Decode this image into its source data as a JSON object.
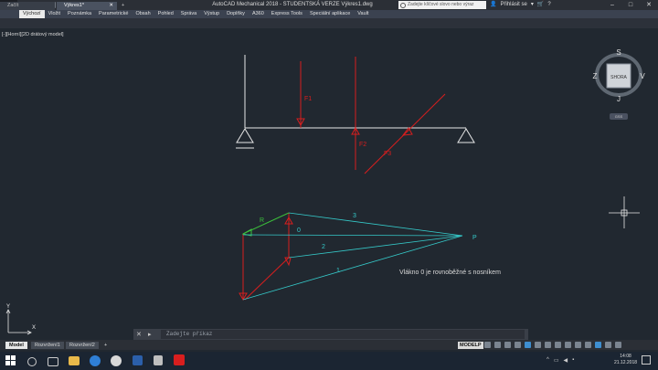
{
  "window": {
    "title": "AutoCAD Mechanical 2018 - STUDENTSKÁ VERZE    Výkres1.dwg",
    "search_placeholder": "Zadejte klíčové slovo nebo výraz",
    "login_label": "Přihlásit se",
    "controls": {
      "minimize": "–",
      "maximize": "□",
      "close": "✕"
    }
  },
  "app_logo": "A",
  "ribbon_tabs": [
    "Výchozí",
    "Vložit",
    "Poznámka",
    "Parametrické",
    "Obsah",
    "Pohled",
    "Správa",
    "Výstup",
    "Doplňky",
    "A360",
    "Express Tools",
    "Speciální aplikace",
    "Vault"
  ],
  "doc_tabs": {
    "start": "Začít",
    "drawing": "Výkres1*",
    "plus": "+"
  },
  "viewport_label": "[-][Horní][2D drátový model]",
  "viewcube": {
    "north": "S",
    "south": "J",
    "east": "V",
    "west": "Z",
    "face": "SHORA",
    "wcs": "GSS"
  },
  "drawing": {
    "force_labels": [
      "F1",
      "F2",
      "F3"
    ],
    "polygon_labels": {
      "resultant": "R",
      "ray0": "0",
      "ray1": "1",
      "ray2": "2",
      "ray3": "3",
      "pole": "P"
    },
    "note": "Vlákno 0 je rovnoběžné s nosníkem"
  },
  "ucs": {
    "x": "X",
    "y": "Y"
  },
  "command": {
    "placeholder": "Zadejte příkaz"
  },
  "layout_tabs": [
    "Model",
    "Rozvržení1",
    "Rozvržení2",
    "+"
  ],
  "status": {
    "space": "MODELP"
  },
  "taskbar": {
    "time": "14:08",
    "date": "21.12.2018"
  },
  "colors": {
    "force": "#d81e1e",
    "polygon": "#35c9c9",
    "resultant": "#3bbf3b",
    "structure": "#e8e8e8",
    "background": "#212830"
  }
}
